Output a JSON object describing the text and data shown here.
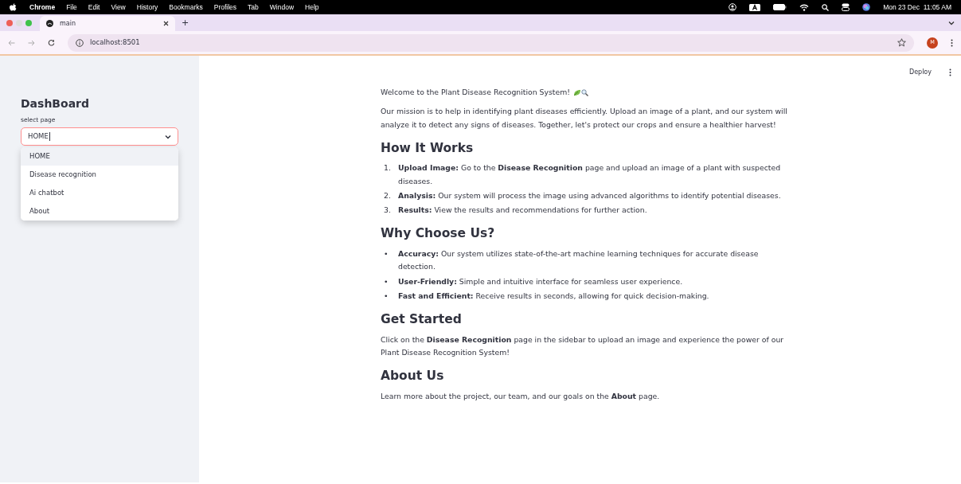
{
  "menubar": {
    "app": "Chrome",
    "menus": [
      "File",
      "Edit",
      "View",
      "History",
      "Bookmarks",
      "Profiles",
      "Tab",
      "Window",
      "Help"
    ],
    "clock": "Mon 23 Dec  11:05 AM"
  },
  "browser": {
    "tabs": [
      {
        "title": "main",
        "selected": true
      }
    ],
    "new_tab": "+",
    "url": "localhost:8501",
    "avatar": "M"
  },
  "sidebar": {
    "title": "DashBoard",
    "select": {
      "label": "select page",
      "value": "HOME",
      "expanded": true,
      "options": [
        {
          "label": "HOME",
          "selected": true
        },
        {
          "label": "Disease recognition",
          "selected": false
        },
        {
          "label": "Ai chatbot",
          "selected": false
        },
        {
          "label": "About",
          "selected": false
        }
      ]
    }
  },
  "header": {
    "deploy": "Deploy"
  },
  "content": [
    {
      "kind": "para",
      "text": "Welcome to the Plant Disease Recognition System!",
      "icons": true
    },
    {
      "kind": "para",
      "text": "Our mission is to help in identifying plant diseases efficiently. Upload an image of a plant, and our system will analyze it to detect any signs of diseases. Together, let's protect our crops and ensure a healthier harvest!"
    },
    {
      "kind": "heading",
      "text": "How It Works"
    },
    {
      "kind": "list",
      "items": [
        {
          "marker": "1.",
          "text": "**Upload Image:** Go to the **Disease Recognition** page and upload an image of a plant with suspected diseases."
        },
        {
          "marker": "2.",
          "text": "**Analysis:** Our system will process the image using advanced algorithms to identify potential diseases."
        },
        {
          "marker": "3.",
          "text": "**Results:** View the results and recommendations for further action."
        }
      ]
    },
    {
      "kind": "heading",
      "text": "Why Choose Us?"
    },
    {
      "kind": "list",
      "items": [
        {
          "marker": "•",
          "text": "**Accuracy:** Our system utilizes state-of-the-art machine learning techniques for accurate disease detection."
        },
        {
          "marker": "•",
          "text": "**User-Friendly:** Simple and intuitive interface for seamless user experience."
        },
        {
          "marker": "•",
          "text": "**Fast and Efficient:** Receive results in seconds, allowing for quick decision-making."
        }
      ]
    },
    {
      "kind": "heading",
      "text": "Get Started"
    },
    {
      "kind": "para",
      "text": "Click on the **Disease Recognition** page in the sidebar to upload an image and experience the power of our Plant Disease Recognition System!"
    },
    {
      "kind": "heading",
      "text": "About Us"
    },
    {
      "kind": "para",
      "text": "Learn more about the project, our team, and our goals on the **About** page."
    }
  ]
}
